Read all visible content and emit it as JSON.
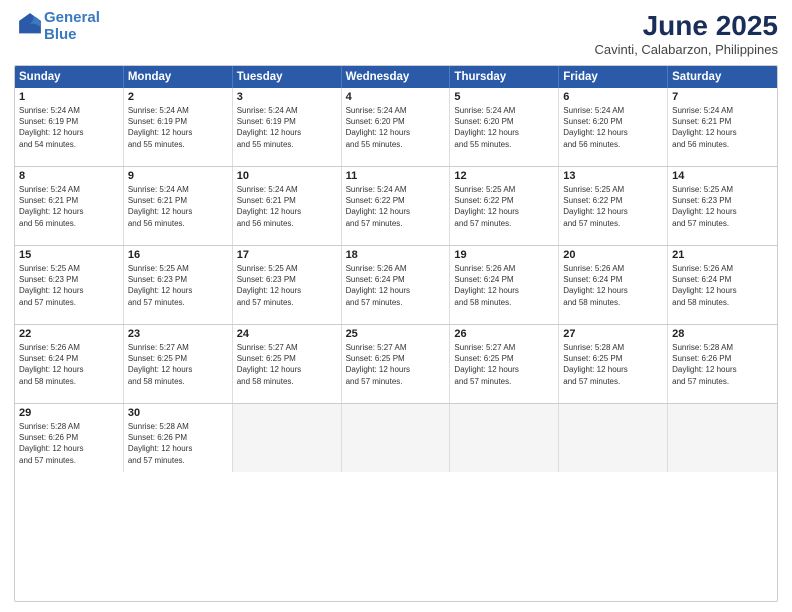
{
  "logo": {
    "line1": "General",
    "line2": "Blue"
  },
  "title": "June 2025",
  "subtitle": "Cavinti, Calabarzon, Philippines",
  "header_days": [
    "Sunday",
    "Monday",
    "Tuesday",
    "Wednesday",
    "Thursday",
    "Friday",
    "Saturday"
  ],
  "rows": [
    [
      {
        "day": "1",
        "info": "Sunrise: 5:24 AM\nSunset: 6:19 PM\nDaylight: 12 hours\nand 54 minutes."
      },
      {
        "day": "2",
        "info": "Sunrise: 5:24 AM\nSunset: 6:19 PM\nDaylight: 12 hours\nand 55 minutes."
      },
      {
        "day": "3",
        "info": "Sunrise: 5:24 AM\nSunset: 6:19 PM\nDaylight: 12 hours\nand 55 minutes."
      },
      {
        "day": "4",
        "info": "Sunrise: 5:24 AM\nSunset: 6:20 PM\nDaylight: 12 hours\nand 55 minutes."
      },
      {
        "day": "5",
        "info": "Sunrise: 5:24 AM\nSunset: 6:20 PM\nDaylight: 12 hours\nand 55 minutes."
      },
      {
        "day": "6",
        "info": "Sunrise: 5:24 AM\nSunset: 6:20 PM\nDaylight: 12 hours\nand 56 minutes."
      },
      {
        "day": "7",
        "info": "Sunrise: 5:24 AM\nSunset: 6:21 PM\nDaylight: 12 hours\nand 56 minutes."
      }
    ],
    [
      {
        "day": "8",
        "info": "Sunrise: 5:24 AM\nSunset: 6:21 PM\nDaylight: 12 hours\nand 56 minutes."
      },
      {
        "day": "9",
        "info": "Sunrise: 5:24 AM\nSunset: 6:21 PM\nDaylight: 12 hours\nand 56 minutes."
      },
      {
        "day": "10",
        "info": "Sunrise: 5:24 AM\nSunset: 6:21 PM\nDaylight: 12 hours\nand 56 minutes."
      },
      {
        "day": "11",
        "info": "Sunrise: 5:24 AM\nSunset: 6:22 PM\nDaylight: 12 hours\nand 57 minutes."
      },
      {
        "day": "12",
        "info": "Sunrise: 5:25 AM\nSunset: 6:22 PM\nDaylight: 12 hours\nand 57 minutes."
      },
      {
        "day": "13",
        "info": "Sunrise: 5:25 AM\nSunset: 6:22 PM\nDaylight: 12 hours\nand 57 minutes."
      },
      {
        "day": "14",
        "info": "Sunrise: 5:25 AM\nSunset: 6:23 PM\nDaylight: 12 hours\nand 57 minutes."
      }
    ],
    [
      {
        "day": "15",
        "info": "Sunrise: 5:25 AM\nSunset: 6:23 PM\nDaylight: 12 hours\nand 57 minutes."
      },
      {
        "day": "16",
        "info": "Sunrise: 5:25 AM\nSunset: 6:23 PM\nDaylight: 12 hours\nand 57 minutes."
      },
      {
        "day": "17",
        "info": "Sunrise: 5:25 AM\nSunset: 6:23 PM\nDaylight: 12 hours\nand 57 minutes."
      },
      {
        "day": "18",
        "info": "Sunrise: 5:26 AM\nSunset: 6:24 PM\nDaylight: 12 hours\nand 57 minutes."
      },
      {
        "day": "19",
        "info": "Sunrise: 5:26 AM\nSunset: 6:24 PM\nDaylight: 12 hours\nand 58 minutes."
      },
      {
        "day": "20",
        "info": "Sunrise: 5:26 AM\nSunset: 6:24 PM\nDaylight: 12 hours\nand 58 minutes."
      },
      {
        "day": "21",
        "info": "Sunrise: 5:26 AM\nSunset: 6:24 PM\nDaylight: 12 hours\nand 58 minutes."
      }
    ],
    [
      {
        "day": "22",
        "info": "Sunrise: 5:26 AM\nSunset: 6:24 PM\nDaylight: 12 hours\nand 58 minutes."
      },
      {
        "day": "23",
        "info": "Sunrise: 5:27 AM\nSunset: 6:25 PM\nDaylight: 12 hours\nand 58 minutes."
      },
      {
        "day": "24",
        "info": "Sunrise: 5:27 AM\nSunset: 6:25 PM\nDaylight: 12 hours\nand 58 minutes."
      },
      {
        "day": "25",
        "info": "Sunrise: 5:27 AM\nSunset: 6:25 PM\nDaylight: 12 hours\nand 57 minutes."
      },
      {
        "day": "26",
        "info": "Sunrise: 5:27 AM\nSunset: 6:25 PM\nDaylight: 12 hours\nand 57 minutes."
      },
      {
        "day": "27",
        "info": "Sunrise: 5:28 AM\nSunset: 6:25 PM\nDaylight: 12 hours\nand 57 minutes."
      },
      {
        "day": "28",
        "info": "Sunrise: 5:28 AM\nSunset: 6:26 PM\nDaylight: 12 hours\nand 57 minutes."
      }
    ],
    [
      {
        "day": "29",
        "info": "Sunrise: 5:28 AM\nSunset: 6:26 PM\nDaylight: 12 hours\nand 57 minutes."
      },
      {
        "day": "30",
        "info": "Sunrise: 5:28 AM\nSunset: 6:26 PM\nDaylight: 12 hours\nand 57 minutes."
      },
      {
        "day": "",
        "info": ""
      },
      {
        "day": "",
        "info": ""
      },
      {
        "day": "",
        "info": ""
      },
      {
        "day": "",
        "info": ""
      },
      {
        "day": "",
        "info": ""
      }
    ]
  ]
}
